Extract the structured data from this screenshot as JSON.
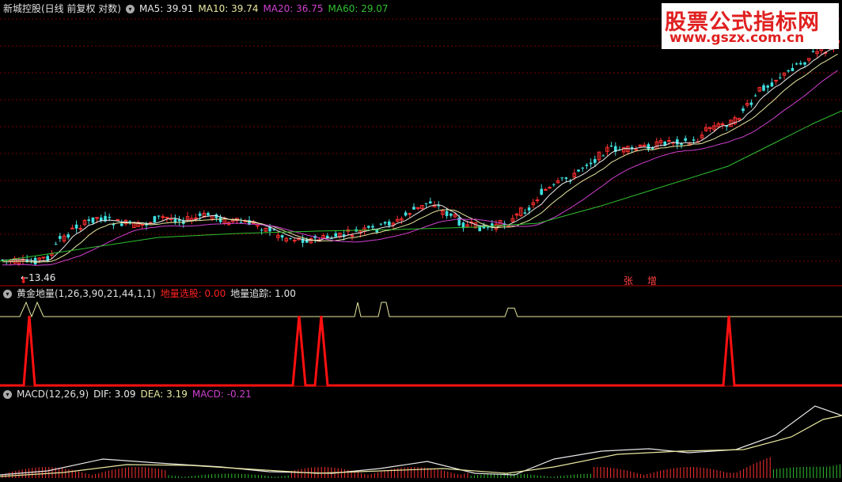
{
  "main_panel": {
    "title": "新城控股(日线 前复权 对数)",
    "indicators": [
      {
        "name": "MA5",
        "label": "MA5: 39.91",
        "color": "#e8e8e8"
      },
      {
        "name": "MA10",
        "label": "MA10: 39.74",
        "color": "#e8e8a0"
      },
      {
        "name": "MA20",
        "label": "MA20: 36.75",
        "color": "#d040d0"
      },
      {
        "name": "MA60",
        "label": "MA60: 29.07",
        "color": "#30c030"
      }
    ],
    "low_marker": "13.46",
    "bottom_tags": [
      "张",
      "增"
    ],
    "watermark": {
      "line1": "股票公式指标网",
      "line2": "www.gszx.com.cn"
    },
    "down_arrow_glyph": "⬇"
  },
  "panel2": {
    "title": "黄金地量(1,26,3,90,21,44,1,1)",
    "items": [
      {
        "label": "地量选股: 0.00",
        "color": "#ff2020"
      },
      {
        "label": "地量追踪: 1.00",
        "color": "#e8e8e8"
      }
    ]
  },
  "panel3": {
    "title": "MACD(12,26,9)",
    "items": [
      {
        "label": "DIF: 3.09",
        "color": "#e8e8e8"
      },
      {
        "label": "DEA: 3.19",
        "color": "#e8e8a0"
      },
      {
        "label": "MACD: -0.21",
        "color": "#d040d0"
      }
    ]
  },
  "chart_data": [
    {
      "type": "line",
      "series": [
        {
          "name": "地量追踪",
          "x": [
            0,
            25,
            33,
            40,
            47,
            55,
            63,
            448,
            452,
            456,
            478,
            482,
            488,
            492,
            638,
            642,
            650,
            654,
            1064
          ],
          "values": [
            1,
            1,
            2,
            1,
            2,
            1,
            1,
            1,
            2,
            1,
            1,
            2,
            2,
            1,
            1,
            1.6,
            1.6,
            1,
            1
          ]
        },
        {
          "name": "地量选股",
          "x": [
            0,
            30,
            37,
            44,
            370,
            378,
            386,
            398,
            406,
            414,
            914,
            921,
            928,
            1064
          ],
          "values": [
            0,
            0,
            1,
            0,
            0,
            1,
            0,
            0,
            1,
            0,
            0,
            1,
            0,
            0
          ]
        }
      ]
    }
  ]
}
